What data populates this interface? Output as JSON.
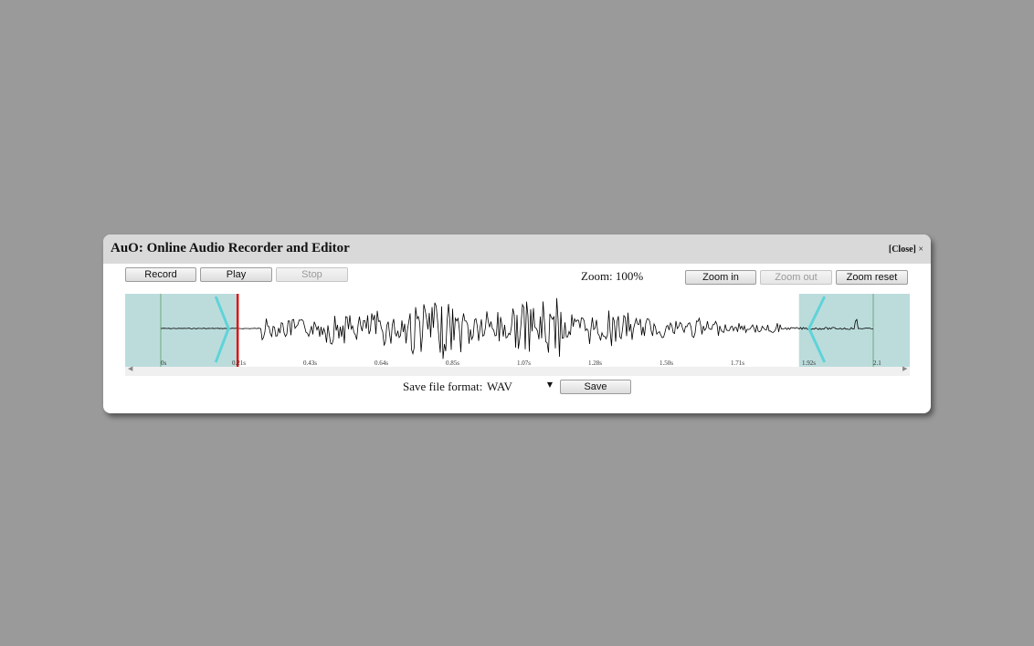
{
  "app": {
    "title": "AuO: Online Audio Recorder and Editor",
    "close_label": "[Close]",
    "close_symbol": "×"
  },
  "toolbar": {
    "record_label": "Record",
    "play_label": "Play",
    "stop_label": "Stop",
    "zoom_text": "Zoom: 100%",
    "zoom_in_label": "Zoom in",
    "zoom_out_label": "Zoom out",
    "zoom_reset_label": "Zoom reset"
  },
  "timeline": {
    "ticks": [
      "0s",
      "0.21s",
      "0.43s",
      "0.64s",
      "0.85s",
      "1.07s",
      "1.28s",
      "1.50s",
      "1.71s",
      "1.92s",
      "2.1"
    ],
    "trim_start_s": 0.23,
    "trim_end_s": 1.92,
    "playhead_s": 0.23
  },
  "save": {
    "format_label": "Save file format:",
    "format_value": "WAV",
    "save_label": "Save"
  },
  "colors": {
    "trim_overlay": "#bcdcdc",
    "trim_handle": "#5fd3d8",
    "playhead": "#e01010",
    "waveform": "#000000"
  },
  "icons": {
    "select_caret": "triangle-down-icon",
    "scroll_left": "scroll-left-arrow-icon",
    "scroll_right": "scroll-right-arrow-icon"
  }
}
